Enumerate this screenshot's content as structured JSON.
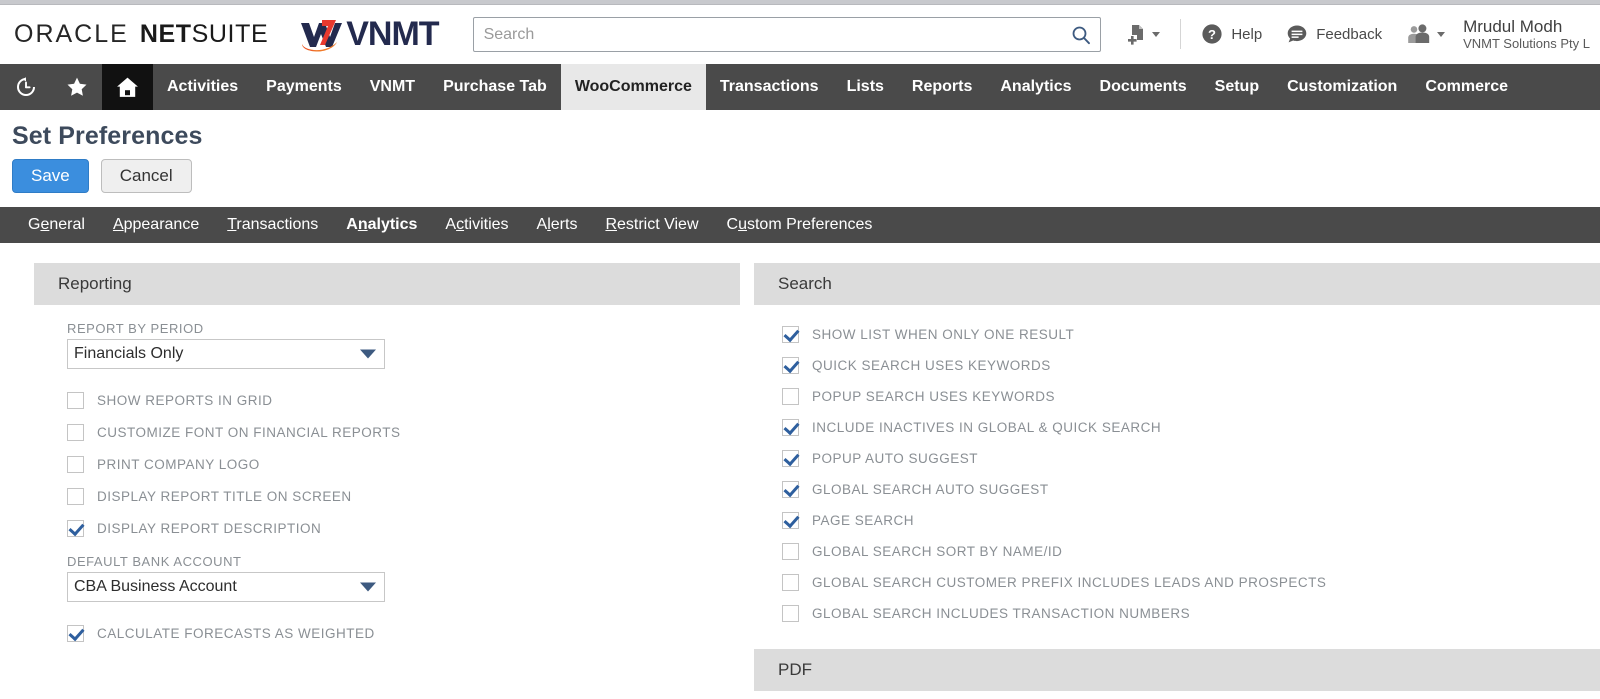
{
  "header": {
    "brand": {
      "oracle": "ORACLE",
      "net": "NET",
      "suite": "SUITE"
    },
    "partner_logo_text": "VNMT",
    "search": {
      "placeholder": "Search",
      "value": "",
      "icon": "search-icon"
    },
    "create_new_icon": "create-new-document-icon",
    "help": {
      "label": "Help",
      "icon": "help-circle-icon"
    },
    "feedback": {
      "label": "Feedback",
      "icon": "chat-bubble-icon"
    },
    "roles_icon": "users-role-icon",
    "user": {
      "name": "Mrudul Modh",
      "org": "VNMT Solutions Pty L"
    }
  },
  "navbar": {
    "icons": [
      {
        "name": "recent-history-icon",
        "glyph": "history"
      },
      {
        "name": "shortcuts-star-icon",
        "glyph": "star"
      },
      {
        "name": "home-icon",
        "glyph": "home",
        "active": true
      }
    ],
    "items": [
      {
        "label": "Activities",
        "active": false
      },
      {
        "label": "Payments",
        "active": false
      },
      {
        "label": "VNMT",
        "active": false
      },
      {
        "label": "Purchase Tab",
        "active": false
      },
      {
        "label": "WooCommerce",
        "active": true
      },
      {
        "label": "Transactions",
        "active": false
      },
      {
        "label": "Lists",
        "active": false
      },
      {
        "label": "Reports",
        "active": false
      },
      {
        "label": "Analytics",
        "active": false
      },
      {
        "label": "Documents",
        "active": false
      },
      {
        "label": "Setup",
        "active": false
      },
      {
        "label": "Customization",
        "active": false
      },
      {
        "label": "Commerce",
        "active": false
      }
    ]
  },
  "page": {
    "title": "Set Preferences",
    "save_label": "Save",
    "cancel_label": "Cancel"
  },
  "subtabs": [
    {
      "pre": "G",
      "key": "e",
      "post": "neral",
      "active": false
    },
    {
      "pre": "",
      "key": "A",
      "post": "ppearance",
      "active": false
    },
    {
      "pre": "",
      "key": "T",
      "post": "ransactions",
      "active": false
    },
    {
      "pre": "A",
      "key": "n",
      "post": "alytics",
      "active": true
    },
    {
      "pre": "A",
      "key": "c",
      "post": "tivities",
      "active": false
    },
    {
      "pre": "A",
      "key": "l",
      "post": "erts",
      "active": false
    },
    {
      "pre": "",
      "key": "R",
      "post": "estrict View",
      "active": false
    },
    {
      "pre": "C",
      "key": "u",
      "post": "stom Preferences",
      "active": false
    }
  ],
  "reporting": {
    "title": "Reporting",
    "report_by_period": {
      "label": "REPORT BY PERIOD",
      "value": "Financials Only"
    },
    "checks_top": [
      {
        "label": "SHOW REPORTS IN GRID",
        "checked": false
      },
      {
        "label": "CUSTOMIZE FONT ON FINANCIAL REPORTS",
        "checked": false
      },
      {
        "label": "PRINT COMPANY LOGO",
        "checked": false
      },
      {
        "label": "DISPLAY REPORT TITLE ON SCREEN",
        "checked": false
      },
      {
        "label": "DISPLAY REPORT DESCRIPTION",
        "checked": true
      }
    ],
    "default_bank_account": {
      "label": "DEFAULT BANK ACCOUNT",
      "value": "CBA Business Account"
    },
    "checks_bottom": [
      {
        "label": "CALCULATE FORECASTS AS WEIGHTED",
        "checked": true
      }
    ]
  },
  "search_panel": {
    "title": "Search",
    "checks": [
      {
        "label": "SHOW LIST WHEN ONLY ONE RESULT",
        "checked": true
      },
      {
        "label": "QUICK SEARCH USES KEYWORDS",
        "checked": true
      },
      {
        "label": "POPUP SEARCH USES KEYWORDS",
        "checked": false
      },
      {
        "label": "INCLUDE INACTIVES IN GLOBAL & QUICK SEARCH",
        "checked": true
      },
      {
        "label": "POPUP AUTO SUGGEST",
        "checked": true
      },
      {
        "label": "GLOBAL SEARCH AUTO SUGGEST",
        "checked": true
      },
      {
        "label": "PAGE SEARCH",
        "checked": true
      },
      {
        "label": "GLOBAL SEARCH SORT BY NAME/ID",
        "checked": false
      },
      {
        "label": "GLOBAL SEARCH CUSTOMER PREFIX INCLUDES LEADS AND PROSPECTS",
        "checked": false
      },
      {
        "label": "GLOBAL SEARCH INCLUDES TRANSACTION NUMBERS",
        "checked": false
      }
    ]
  },
  "pdf_panel": {
    "title": "PDF"
  },
  "colors": {
    "nav_bg": "#4a4a4a",
    "nav_active_bg": "#e8e8e8",
    "home_bg": "#111111",
    "panel_head_bg": "#dcdcdc",
    "save_blue": "#3b8ede",
    "title_color": "#3d4a5c",
    "label_gray": "#8a8f94",
    "check_blue": "#2e5f9e"
  }
}
